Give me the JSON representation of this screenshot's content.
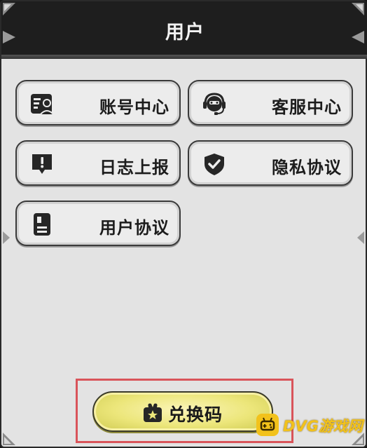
{
  "header": {
    "title": "用户"
  },
  "menu": {
    "items": [
      {
        "label": "账号中心",
        "icon": "account-card-icon"
      },
      {
        "label": "客服中心",
        "icon": "headset-icon"
      },
      {
        "label": "日志上报",
        "icon": "report-alert-icon"
      },
      {
        "label": "隐私协议",
        "icon": "shield-check-icon"
      },
      {
        "label": "用户协议",
        "icon": "agreement-doc-icon"
      }
    ]
  },
  "redeem": {
    "label": "兑换码",
    "icon": "gift-star-icon",
    "accent": "#ece67a",
    "highlight_color": "#d9545a"
  },
  "watermark": {
    "text": "DVG游戏网",
    "color": "#f2c21b"
  }
}
